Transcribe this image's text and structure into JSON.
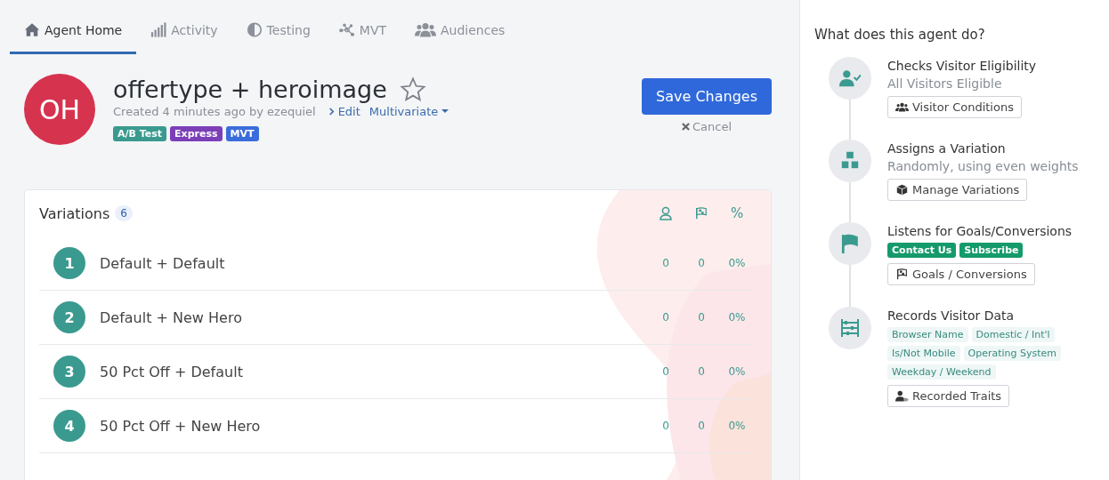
{
  "tabs": [
    {
      "label": "Agent Home",
      "selected": true
    },
    {
      "label": "Activity",
      "selected": false
    },
    {
      "label": "Testing",
      "selected": false
    },
    {
      "label": "MVT",
      "selected": false
    },
    {
      "label": "Audiences",
      "selected": false
    }
  ],
  "agent": {
    "initials": "OH",
    "title": "offertype + heroimage",
    "starred": false,
    "created": "Created 4 minutes ago by ezequiel",
    "edit_link": "Edit",
    "mode": "Multivariate",
    "tags": [
      {
        "label": "A/B Test",
        "color": "#3a9a8f"
      },
      {
        "label": "Express",
        "color": "#7b3fb8"
      },
      {
        "label": "MVT",
        "color": "#3a6ddb"
      }
    ]
  },
  "actions": {
    "save": "Save Changes",
    "cancel": "Cancel"
  },
  "variations": {
    "title": "Variations",
    "count": "6",
    "percent_header": "%",
    "rows": [
      {
        "number": "1",
        "name": "Default + Default",
        "visitors": "0",
        "conversions": "0",
        "rate": "0%"
      },
      {
        "number": "2",
        "name": "Default + New Hero",
        "visitors": "0",
        "conversions": "0",
        "rate": "0%"
      },
      {
        "number": "3",
        "name": "50 Pct Off + Default",
        "visitors": "0",
        "conversions": "0",
        "rate": "0%"
      },
      {
        "number": "4",
        "name": "50 Pct Off + New Hero",
        "visitors": "0",
        "conversions": "0",
        "rate": "0%"
      }
    ]
  },
  "sidebar": {
    "title": "What does this agent do?",
    "steps": [
      {
        "title": "Checks Visitor Eligibility",
        "subtitle": "All Visitors Eligible",
        "button": "Visitor Conditions"
      },
      {
        "title": "Assigns a Variation",
        "subtitle": "Randomly, using even weights",
        "button": "Manage Variations"
      },
      {
        "title": "Listens for Goals/Conversions",
        "goals": [
          "Contact Us",
          "Subscribe"
        ],
        "button": "Goals / Conversions"
      },
      {
        "title": "Records Visitor Data",
        "traits": [
          "Browser Name",
          "Domestic / Int'l",
          "Is/Not Mobile",
          "Operating System",
          "Weekday / Weekend"
        ],
        "button": "Recorded Traits"
      }
    ]
  }
}
